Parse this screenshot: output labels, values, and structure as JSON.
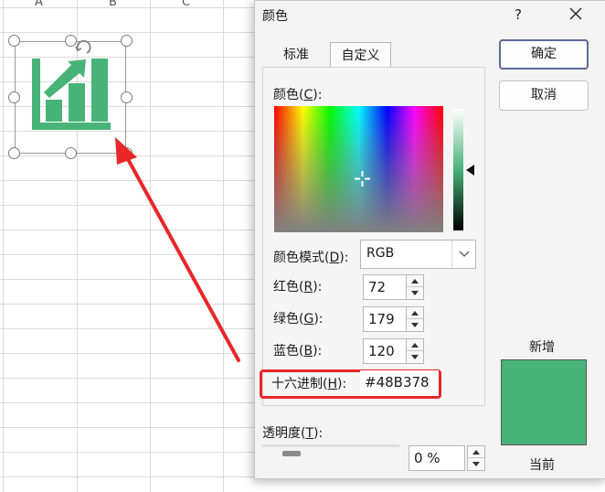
{
  "sheet": {
    "columns": [
      "A",
      "B",
      "C"
    ]
  },
  "picture": {
    "icon": "bar-chart-growth-icon",
    "color": "#48B378"
  },
  "dialog": {
    "title": "颜色",
    "help_label": "?",
    "tabs": [
      {
        "label": "标准",
        "active": false
      },
      {
        "label": "自定义",
        "active": true
      }
    ],
    "colors_label": {
      "text": "颜色",
      "key": "C"
    },
    "color_mode": {
      "text": "颜色模式",
      "key": "D",
      "value": "RGB"
    },
    "red": {
      "text": "红色",
      "key": "R",
      "value": "72"
    },
    "green": {
      "text": "绿色",
      "key": "G",
      "value": "179"
    },
    "blue": {
      "text": "蓝色",
      "key": "B",
      "value": "120"
    },
    "hex": {
      "text": "十六进制",
      "key": "H",
      "value": "#48B378"
    },
    "transparency": {
      "text": "透明度",
      "key": "T",
      "value": "0 %"
    },
    "ok_label": "确定",
    "cancel_label": "取消",
    "new_label": "新增",
    "current_label": "当前",
    "new_color": "#48B378",
    "current_color": "#48B378",
    "highlight_color": "#e8272b"
  }
}
